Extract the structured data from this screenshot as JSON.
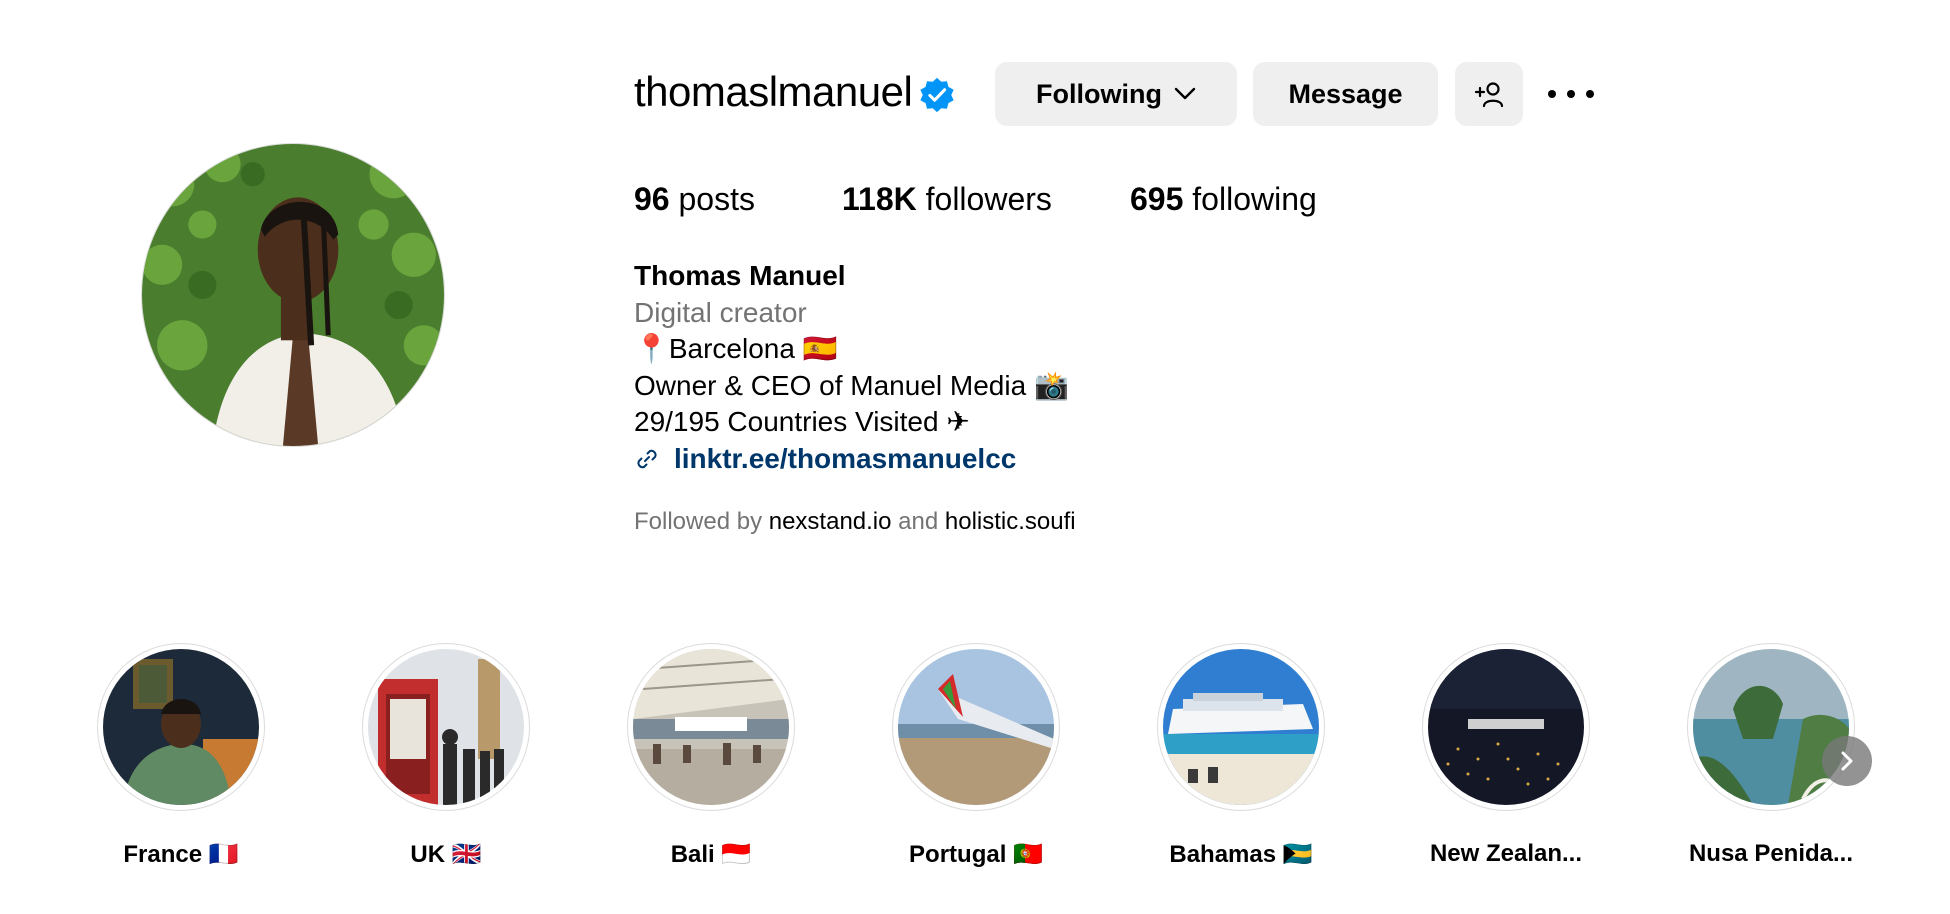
{
  "profile": {
    "username": "thomaslmanuel",
    "verified": true,
    "avatar_icon": "profile-photo"
  },
  "actions": {
    "following_label": "Following",
    "message_label": "Message",
    "add_user_icon": "add-user-icon",
    "more_icon": "more-options-icon"
  },
  "stats": {
    "posts_count": "96",
    "posts_label": "posts",
    "followers_count": "118K",
    "followers_label": "followers",
    "following_count": "695",
    "following_label": "following"
  },
  "bio": {
    "name": "Thomas Manuel",
    "category": "Digital creator",
    "lines": [
      "📍Barcelona 🇪🇸",
      "Owner & CEO of Manuel Media 📸",
      "29/195 Countries Visited ✈"
    ],
    "link": "linktr.ee/thomasmanuelcc"
  },
  "followed_by": {
    "prefix": "Followed by",
    "user1": "nexstand.io",
    "conjunction": "and",
    "user2": "holistic.soufi"
  },
  "highlights": [
    {
      "label": "France 🇫🇷"
    },
    {
      "label": "UK 🇬🇧"
    },
    {
      "label": "Bali 🇮🇩"
    },
    {
      "label": "Portugal 🇵🇹"
    },
    {
      "label": "Bahamas 🇧🇸"
    },
    {
      "label": "New Zealan..."
    },
    {
      "label": "Nusa Penida..."
    }
  ],
  "colors": {
    "verified_blue": "#0095f6",
    "link_blue": "#00376b",
    "button_bg": "#efefef",
    "muted_text": "#737373"
  }
}
